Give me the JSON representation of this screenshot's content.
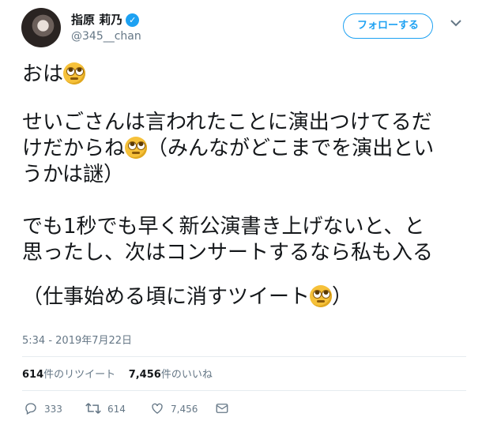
{
  "header": {
    "display_name": "指原 莉乃",
    "handle": "@345__chan",
    "follow_label": "フォローする"
  },
  "tweet": {
    "lines": {
      "l1": "おは",
      "l2": "せいごさんは言われたことに演出つけてるだ",
      "l3": "けだからね",
      "l3b": "（みんながどこまでを演出とい",
      "l4": "うかは謎）",
      "l5": "でも1秒でも早く新公演書き上げないと、と",
      "l6": "思ったし、次はコンサートするなら私も入る",
      "l7": "（仕事始める頃に消すツイート",
      "l7b": "）"
    },
    "emoji_name": "face-with-rolling-eyes",
    "timestamp": "5:34 - 2019年7月22日"
  },
  "stats": {
    "retweets_count": "614",
    "retweets_label": "件のリツイート",
    "likes_count": "7,456",
    "likes_label": "件のいいね"
  },
  "actions": {
    "reply_count": "333",
    "retweet_count": "614",
    "like_count": "7,456"
  },
  "colors": {
    "accent": "#1da1f2",
    "text": "#14171a",
    "muted": "#657786",
    "divider": "#e6ecf0"
  }
}
